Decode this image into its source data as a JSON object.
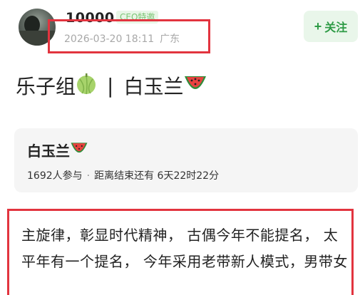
{
  "user": {
    "name": "10000",
    "badge": "CEO特邀",
    "date": "2026-03-20 18:11",
    "location": "广东"
  },
  "follow_button": {
    "plus": "+",
    "label": "关注"
  },
  "post": {
    "title_left": "乐子组",
    "separator": "|",
    "title_right": "白玉兰",
    "icons": [
      "melon-icon",
      "watermelon-icon"
    ]
  },
  "poll_card": {
    "title": "白玉兰",
    "participants": "1692人参与",
    "dot": "·",
    "countdown": "距离结束还有 6天22时22分"
  },
  "content": {
    "text": "主旋律，彰显时代精神， 古偶今年不能提名， 太平年有一个提名， 今年采用老带新人模式，男带女"
  },
  "colors": {
    "highlight_border": "#e2343f",
    "follow_text": "#2e9b46",
    "follow_bg": "#e9f6ea",
    "badge_text": "#7cc576"
  }
}
